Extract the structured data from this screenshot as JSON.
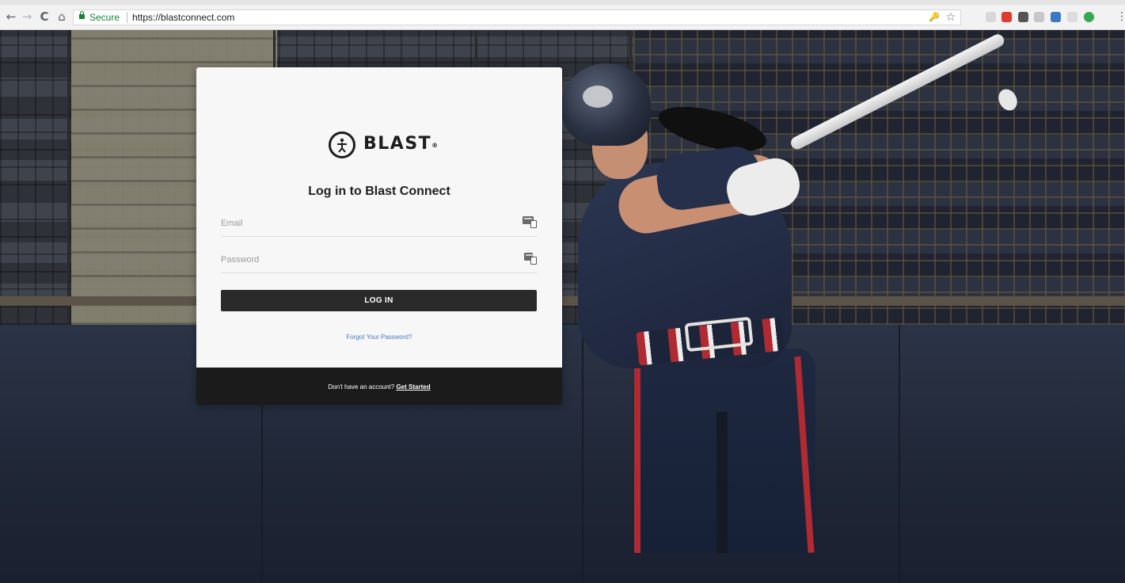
{
  "browser": {
    "nav": {
      "back_icon": "←",
      "forward_icon": "→",
      "reload_icon": "C",
      "home_icon": "⌂"
    },
    "secure_label": "Secure",
    "url": "https://blastconnect.com",
    "key_icon": "🔑",
    "bookmark_icon": "☆",
    "menu_icon": "⋮",
    "extension_colors": [
      "#d8d8d8",
      "#e03a2f",
      "#555555",
      "#c7c7c7",
      "#3a78c3",
      "#dcdcdc",
      "#34a853"
    ]
  },
  "login": {
    "brand": "BLAST",
    "brand_mark": "®",
    "title": "Log in to Blast Connect",
    "email": {
      "placeholder": "Email",
      "value": ""
    },
    "password": {
      "placeholder": "Password",
      "value": ""
    },
    "submit_label": "LOG IN",
    "forgot_label": "Forgot Your Password?",
    "signup_prompt": "Don't have an account?",
    "signup_link": "Get Started"
  },
  "colors": {
    "primary_button": "#2a2a2a",
    "link": "#4a78c0",
    "secure": "#188038",
    "footer": "#1b1b1b"
  }
}
